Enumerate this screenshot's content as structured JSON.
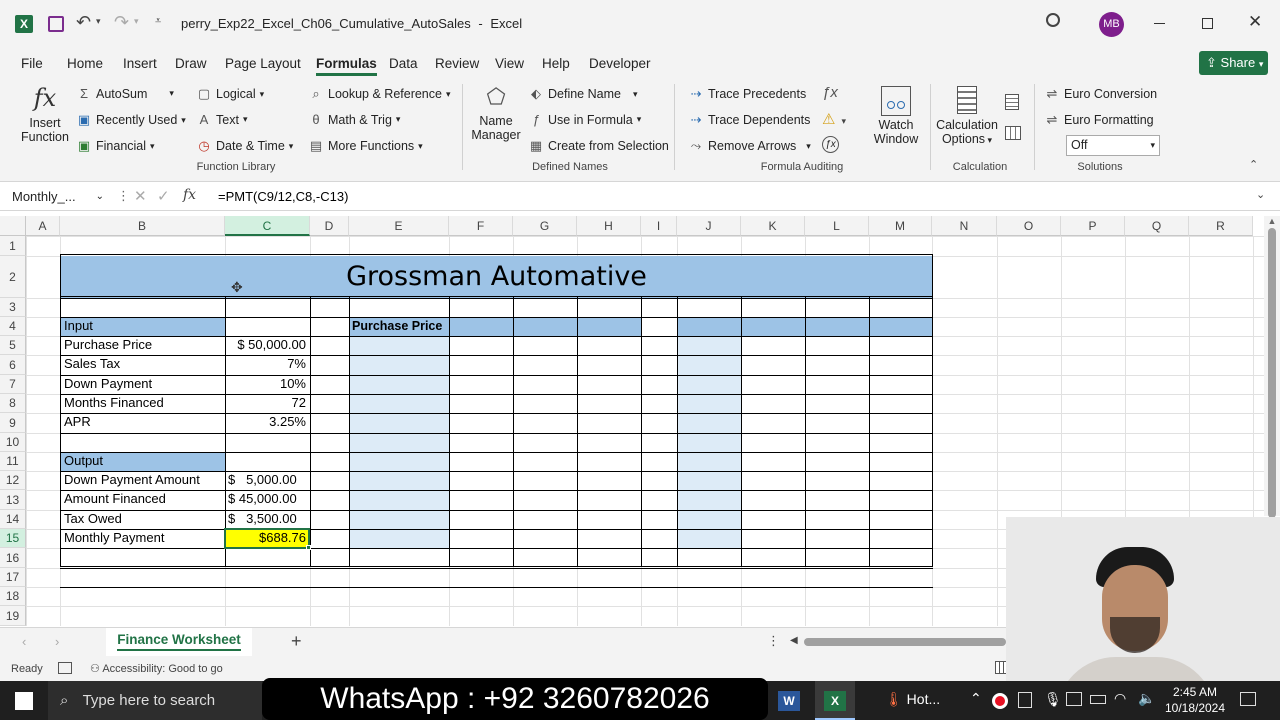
{
  "titlebar": {
    "filename": "perry_Exp22_Excel_Ch06_Cumulative_AutoSales",
    "separator": "-",
    "app": "Excel",
    "avatar": "MB"
  },
  "menu": [
    "File",
    "Home",
    "Insert",
    "Draw",
    "Page Layout",
    "Formulas",
    "Data",
    "Review",
    "View",
    "Help",
    "Developer"
  ],
  "share_label": "Share",
  "ribbon": {
    "insert_function": [
      "Insert",
      "Function"
    ],
    "fx": "fx",
    "lib": {
      "autosum": "AutoSum",
      "recent": "Recently Used",
      "financial": "Financial",
      "logical": "Logical",
      "text": "Text",
      "datetime": "Date & Time",
      "lookup": "Lookup & Reference",
      "math": "Math & Trig",
      "more": "More Functions",
      "group": "Function Library"
    },
    "names": {
      "manager": [
        "Name",
        "Manager"
      ],
      "define": "Define Name",
      "use": "Use in Formula",
      "create": "Create from Selection",
      "group": "Defined Names"
    },
    "audit": {
      "prec": "Trace Precedents",
      "dep": "Trace Dependents",
      "remove": "Remove Arrows",
      "watch": [
        "Watch",
        "Window"
      ],
      "group": "Formula Auditing"
    },
    "calc": {
      "options": [
        "Calculation",
        "Options"
      ],
      "group": "Calculation"
    },
    "sol": {
      "euro_conv": "Euro Conversion",
      "euro_fmt": "Euro Formatting",
      "select": "Off",
      "group": "Solutions"
    }
  },
  "formula_bar": {
    "name_box": "Monthly_...",
    "formula": "=PMT(C9/12,C8,-C13)",
    "fx": "fx"
  },
  "columns": [
    "A",
    "B",
    "C",
    "D",
    "E",
    "F",
    "G",
    "H",
    "I",
    "J",
    "K",
    "L",
    "M",
    "N",
    "O",
    "P",
    "Q",
    "R"
  ],
  "rows": [
    "1",
    "2",
    "3",
    "4",
    "5",
    "6",
    "7",
    "8",
    "9",
    "10",
    "11",
    "12",
    "13",
    "14",
    "15",
    "16",
    "17",
    "18",
    "19"
  ],
  "sheet": {
    "title": "Grossman Automative",
    "input_header": "Input",
    "output_header": "Output",
    "purchase_price_header": "Purchase Price",
    "inputs": [
      {
        "label": "Purchase Price",
        "value": "$ 50,000.00"
      },
      {
        "label": "Sales Tax",
        "value": "7%"
      },
      {
        "label": "Down Payment",
        "value": "10%"
      },
      {
        "label": "Months Financed",
        "value": "72"
      },
      {
        "label": "APR",
        "value": "3.25%"
      }
    ],
    "outputs": [
      {
        "label": "Down Payment Amount",
        "value": "$   5,000.00"
      },
      {
        "label": "Amount Financed",
        "value": "$ 45,000.00"
      },
      {
        "label": "Tax Owed",
        "value": "$   3,500.00"
      },
      {
        "label": "Monthly Payment",
        "value": "$688.76"
      }
    ]
  },
  "sheet_tab": "Finance Worksheet",
  "status": {
    "ready": "Ready",
    "accessibility": "Accessibility: Good to go"
  },
  "taskbar": {
    "search": "Type here to search",
    "banner": "WhatsApp : +92 3260782026",
    "hot": "Hot...",
    "time": "2:45 AM",
    "date": "10/18/2024"
  },
  "colors": {
    "excel_green": "#217346",
    "header_blue": "#9dc3e6",
    "light_blue": "#ddebf7",
    "yellow": "#ffff00"
  }
}
